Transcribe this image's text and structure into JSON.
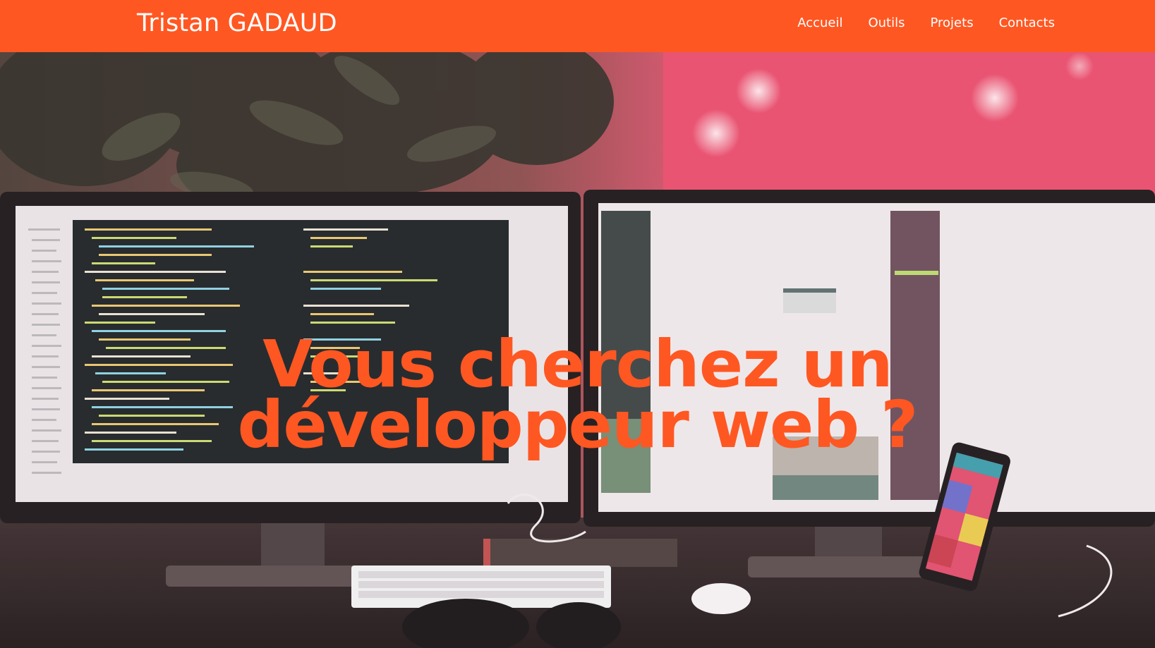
{
  "header": {
    "brand": "Tristan GADAUD",
    "nav": [
      {
        "label": "Accueil"
      },
      {
        "label": "Outils"
      },
      {
        "label": "Projets"
      },
      {
        "label": "Contacts"
      }
    ]
  },
  "hero": {
    "title_line1": "Vous cherchez un",
    "title_line2": "développeur web ?",
    "background_image": "desk with two monitors showing code, keyboard, smartphone, plant and red wall"
  },
  "colors": {
    "accent": "#ff5722",
    "nav_text": "#ffffff"
  }
}
